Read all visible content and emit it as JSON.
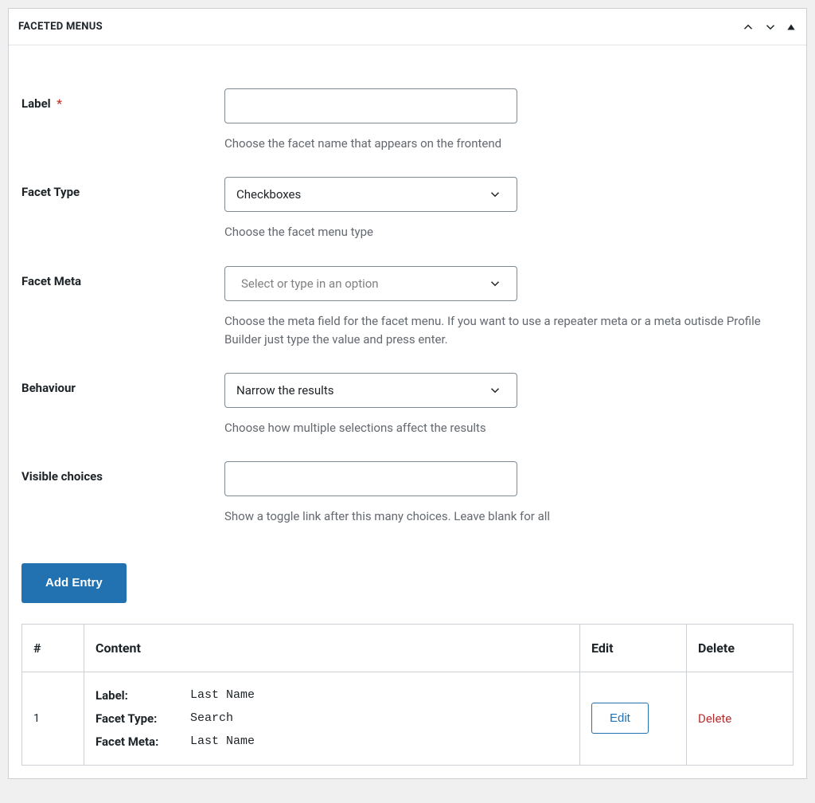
{
  "metabox": {
    "title": "FACETED MENUS"
  },
  "fields": {
    "label": {
      "label": "Label",
      "required_mark": "*",
      "value": "",
      "help": "Choose the facet name that appears on the frontend"
    },
    "facet_type": {
      "label": "Facet Type",
      "selected": "Checkboxes",
      "help": "Choose the facet menu type"
    },
    "facet_meta": {
      "label": "Facet Meta",
      "placeholder": "Select or type in an option",
      "help": "Choose the meta field for the facet menu. If you want to use a repeater meta or a meta outisde Profile Builder just type the value and press enter."
    },
    "behaviour": {
      "label": "Behaviour",
      "selected": "Narrow the results",
      "help": "Choose how multiple selections affect the results"
    },
    "visible_choices": {
      "label": "Visible choices",
      "value": "",
      "help": "Show a toggle link after this many choices. Leave blank for all"
    }
  },
  "buttons": {
    "add_entry": "Add Entry"
  },
  "table": {
    "headers": {
      "num": "#",
      "content": "Content",
      "edit": "Edit",
      "delete": "Delete"
    },
    "rows": [
      {
        "num": "1",
        "label_key": "Label:",
        "label_val": "Last Name",
        "type_key": "Facet Type:",
        "type_val": "Search",
        "meta_key": "Facet Meta:",
        "meta_val": "Last Name",
        "edit": "Edit",
        "delete": "Delete"
      }
    ]
  }
}
